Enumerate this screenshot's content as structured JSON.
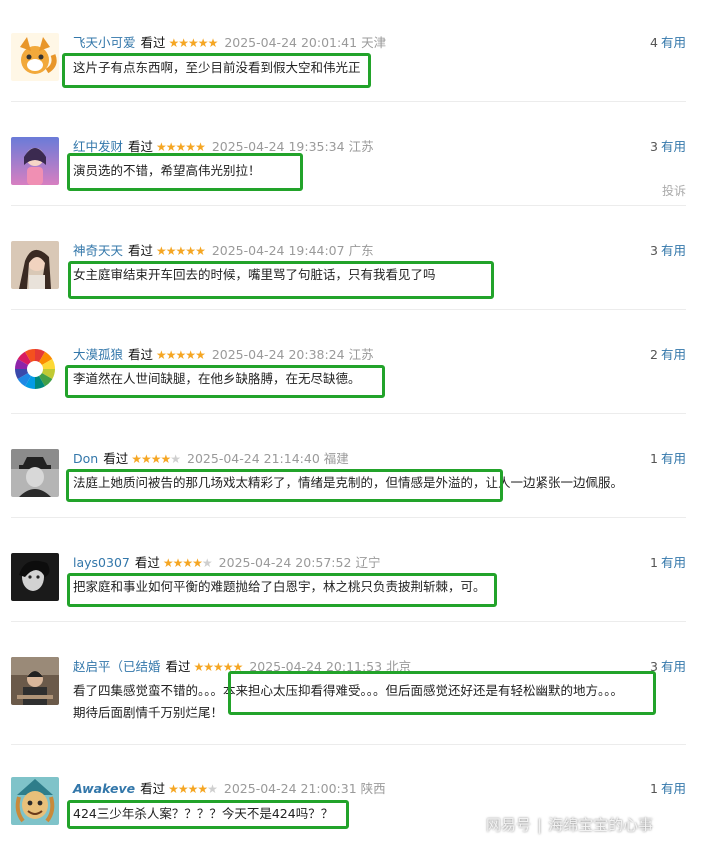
{
  "reviews": [
    {
      "user": "飞天小可爱",
      "watched": "看过",
      "rating": 5,
      "time": "2025-04-24 20:01:41",
      "location": "天津",
      "useful_count": "4",
      "useful_label": "有用",
      "text": "这片子有点东西啊，至少目前没看到假大空和伟光正"
    },
    {
      "user": "红中发财",
      "watched": "看过",
      "rating": 5,
      "time": "2025-04-24 19:35:34",
      "location": "江苏",
      "useful_count": "3",
      "useful_label": "有用",
      "text": "演员选的不错，希望高伟光别拉！",
      "report": "投诉"
    },
    {
      "user": "神奇天天",
      "watched": "看过",
      "rating": 5,
      "time": "2025-04-24 19:44:07",
      "location": "广东",
      "useful_count": "3",
      "useful_label": "有用",
      "text": "女主庭审结束开车回去的时候，嘴里骂了句脏话，只有我看见了吗"
    },
    {
      "user": "大漠孤狼",
      "watched": "看过",
      "rating": 5,
      "time": "2025-04-24 20:38:24",
      "location": "江苏",
      "useful_count": "2",
      "useful_label": "有用",
      "text": "李道然在人世间缺腿，在他乡缺胳膊，在无尽缺德。"
    },
    {
      "user": "Don",
      "watched": "看过",
      "rating": 4,
      "time": "2025-04-24 21:14:40",
      "location": "福建",
      "useful_count": "1",
      "useful_label": "有用",
      "text": "法庭上她质问被告的那几场戏太精彩了，情绪是克制的，但情感是外溢的，让人一边紧张一边佩服。"
    },
    {
      "user": "lays0307",
      "watched": "看过",
      "rating": 4,
      "time": "2025-04-24 20:57:52",
      "location": "辽宁",
      "useful_count": "1",
      "useful_label": "有用",
      "text": "把家庭和事业如何平衡的难题抛给了白恩宇，林之桃只负责披荆斩棘，可。"
    },
    {
      "user": "赵启平（已结婚",
      "watched": "看过",
      "rating": 5,
      "time": "2025-04-24 20:11:53",
      "location": "北京",
      "useful_count": "3",
      "useful_label": "有用",
      "text": "看了四集感觉蛮不错的。。。本来担心太压抑看得难受。。。但后面感觉还好还是有轻松幽默的地方。。。",
      "text2": "期待后面剧情千万别烂尾！"
    },
    {
      "user": "Awakeve",
      "watched": "看过",
      "rating": 4,
      "time": "2025-04-24 21:00:31",
      "location": "陕西",
      "useful_count": "1",
      "useful_label": "有用",
      "text": "424三少年杀人案？？？？今天不是424吗？？"
    }
  ],
  "watermark": {
    "brand": "网易号",
    "separator": "|",
    "author": "海绵宝宝的心事"
  },
  "colors": {
    "link": "#3377aa",
    "star": "#f5a623",
    "highlight": "#22a32a",
    "muted": "#9a9a9a"
  },
  "icons": {
    "star": "star-icon",
    "avatar": "avatar"
  }
}
